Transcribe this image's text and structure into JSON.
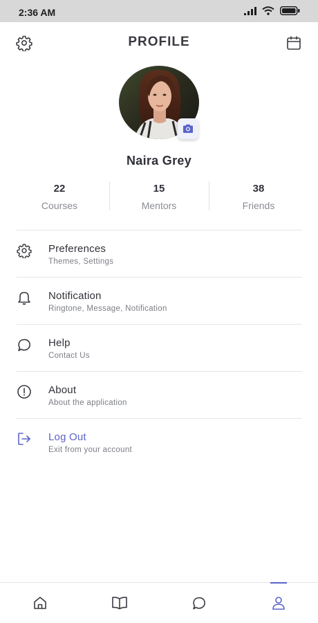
{
  "status_bar": {
    "time": "2:36 AM"
  },
  "header": {
    "title": "PROFILE",
    "left_icon": "gear-icon",
    "right_icon": "calendar-icon"
  },
  "profile": {
    "name": "Naira Grey",
    "camera_icon": "camera-icon"
  },
  "stats": [
    {
      "value": "22",
      "label": "Courses"
    },
    {
      "value": "15",
      "label": "Mentors"
    },
    {
      "value": "38",
      "label": "Friends"
    }
  ],
  "menu": [
    {
      "title": "Preferences",
      "subtitle": "Themes, Settings",
      "icon": "gear-icon"
    },
    {
      "title": "Notification",
      "subtitle": "Ringtone, Message, Notification",
      "icon": "bell-icon"
    },
    {
      "title": "Help",
      "subtitle": "Contact Us",
      "icon": "chat-bubble-icon"
    },
    {
      "title": "About",
      "subtitle": "About the application",
      "icon": "info-circle-icon"
    },
    {
      "title": "Log Out",
      "subtitle": "Exit from your account",
      "icon": "logout-icon"
    }
  ],
  "bottom_nav": [
    {
      "icon": "home-icon",
      "active": false
    },
    {
      "icon": "book-icon",
      "active": false
    },
    {
      "icon": "chat-bubble-icon",
      "active": false
    },
    {
      "icon": "user-icon",
      "active": true
    }
  ],
  "colors": {
    "accent": "#5a63c8",
    "text": "#2f3137",
    "muted": "#8a8c93",
    "divider": "#e6e6e6",
    "status_bar": "#d8d8d8"
  }
}
